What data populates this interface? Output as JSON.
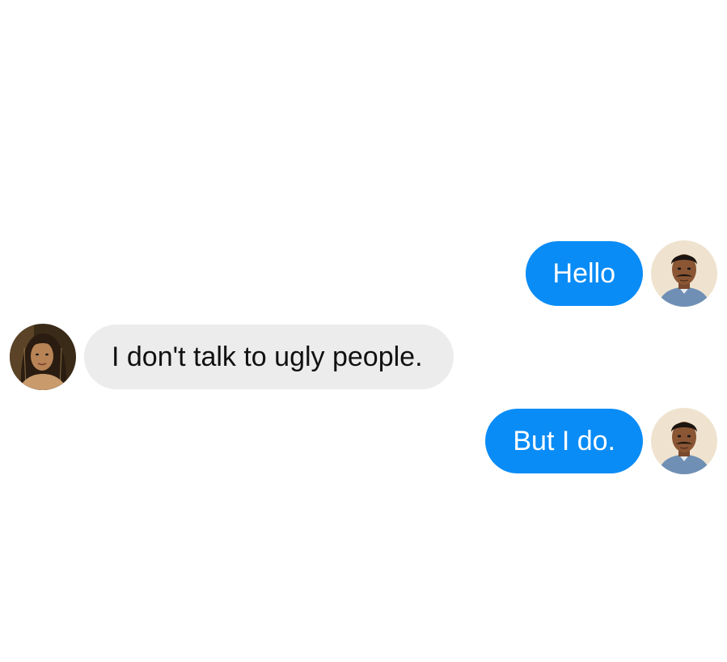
{
  "messages": [
    {
      "direction": "outgoing",
      "text": "Hello",
      "avatar_icon": "man-avatar-icon"
    },
    {
      "direction": "incoming",
      "text": "I don't talk to ugly people.",
      "avatar_icon": "woman-avatar-icon"
    },
    {
      "direction": "outgoing",
      "text": "But I do.",
      "avatar_icon": "man-avatar-icon"
    }
  ],
  "colors": {
    "sent_bubble": "#0a8cf6",
    "received_bubble": "#ececec",
    "background": "#ffffff"
  }
}
